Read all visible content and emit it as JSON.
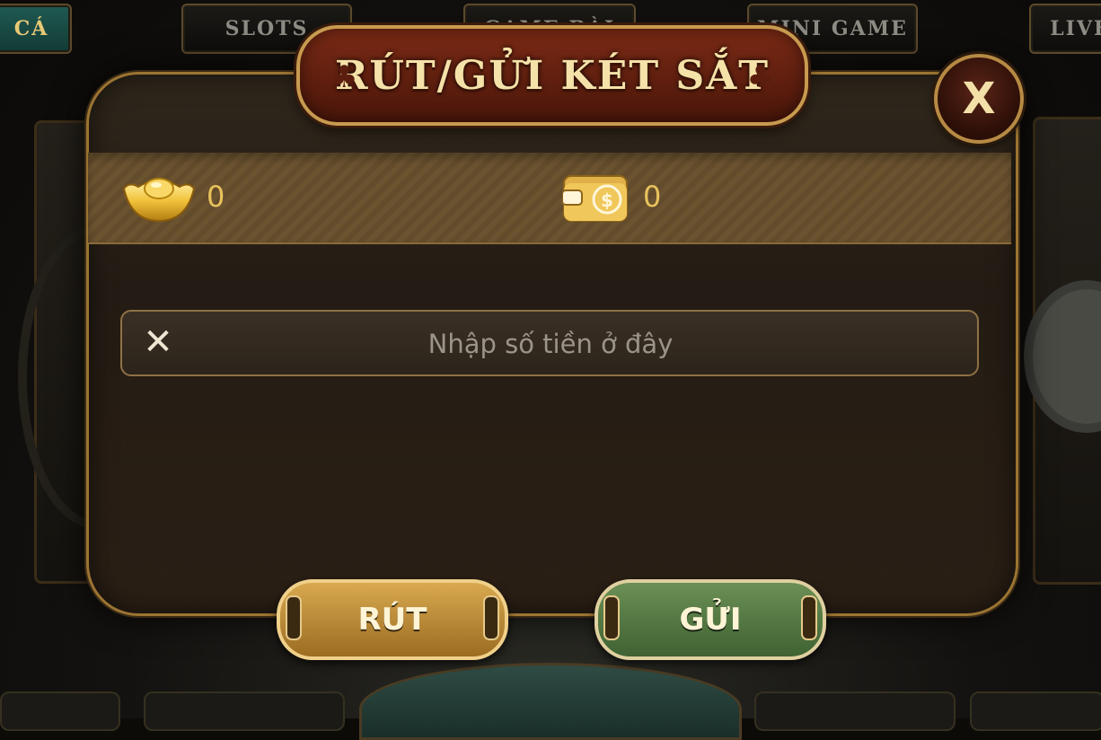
{
  "lobby": {
    "tabs": [
      {
        "label": "CÁ"
      },
      {
        "label": "SLOTS"
      },
      {
        "label": "GAME BÀI"
      },
      {
        "label": "MINI GAME"
      },
      {
        "label": "LIVE"
      }
    ]
  },
  "modal": {
    "title": "RÚT/GỬI KÉT SẮT",
    "close_label": "X",
    "balances": {
      "gold_amount": "0",
      "wallet_amount": "0",
      "gold_icon": "gold-ingot-icon",
      "wallet_icon": "wallet-coin-icon"
    },
    "amount_input": {
      "placeholder": "Nhập số tiền ở đây",
      "value": "",
      "clear_icon": "close-icon"
    },
    "buttons": {
      "withdraw_label": "RÚT",
      "deposit_label": "GỬI"
    }
  },
  "colors": {
    "accent_gold": "#e9c25c",
    "title_red": "#7b2a15",
    "deposit_green": "#5a7f47",
    "withdraw_gold": "#c4943d"
  }
}
